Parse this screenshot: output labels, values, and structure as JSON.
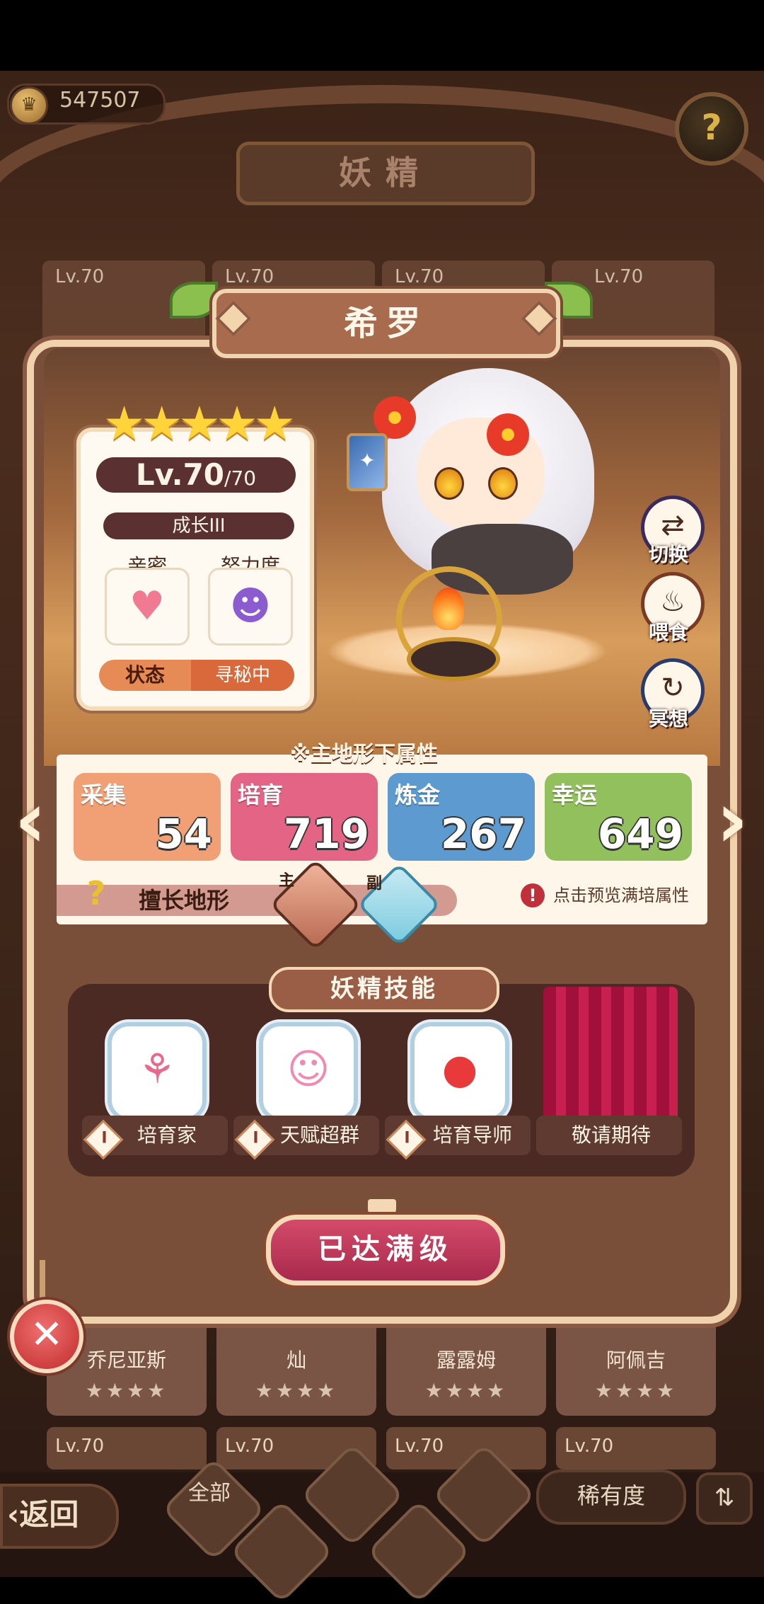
{
  "header": {
    "coins": "547507",
    "title": "妖精"
  },
  "background_cards": {
    "level_label": "Lv.70",
    "bottom_names": [
      "乔尼亚斯",
      "灿",
      "露露姆",
      "阿佩吉"
    ],
    "stars": "★★★★"
  },
  "fairy": {
    "name": "希罗",
    "stars": "★★★★★",
    "level": "Lv.70",
    "level_max": "/70",
    "growth": "成长III",
    "intimacy_label": "亲密",
    "effort_label": "努力度",
    "status_label": "状态",
    "status_value": "寻秘中"
  },
  "actions": {
    "switch": "切换",
    "feed": "喂食",
    "meditate": "冥想"
  },
  "attributes": {
    "header": "※主地形下属性",
    "items": [
      {
        "name": "采集",
        "value": "54",
        "color": "#f0a074"
      },
      {
        "name": "培育",
        "value": "719",
        "color": "#e36484"
      },
      {
        "name": "炼金",
        "value": "267",
        "color": "#5d9ad0"
      },
      {
        "name": "幸运",
        "value": "649",
        "color": "#92c05c"
      }
    ],
    "terrain_label": "擅长地形",
    "terrain_main_tag": "主",
    "terrain_sub_tag": "副",
    "preview_text": "点击预览满培属性"
  },
  "skills": {
    "header": "妖精技能",
    "items": [
      {
        "name": "培育家",
        "badge": "I"
      },
      {
        "name": "天赋超群",
        "badge": "I"
      },
      {
        "name": "培育导师",
        "badge": "I"
      }
    ],
    "coming_soon": "敬请期待"
  },
  "max_level_button": "已达满级",
  "bottom_bar": {
    "back": "返回",
    "all": "全部",
    "rarity": "稀有度"
  }
}
